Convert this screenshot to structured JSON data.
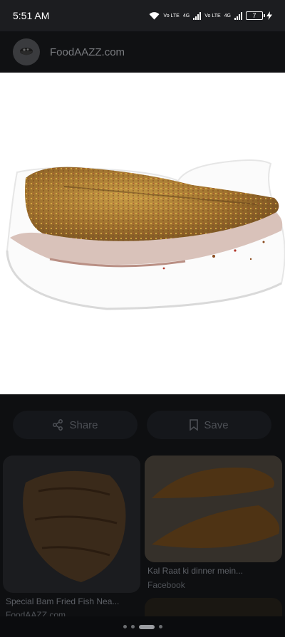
{
  "status_bar": {
    "time": "5:51 AM",
    "net1": "Vo LTE",
    "net2": "4G",
    "net3": "Vo LTE",
    "net4": "4G",
    "battery": "7"
  },
  "header": {
    "site_name": "FoodAAZZ.com"
  },
  "actions": {
    "share_label": "Share",
    "save_label": "Save"
  },
  "related": [
    {
      "title": "Special Bam Fried Fish Nea...",
      "source": "FoodAAZZ.com"
    },
    {
      "title": "Kal Raat ki dinner mein...",
      "source": "Facebook"
    }
  ],
  "colors": {
    "accent": "#e8a33c",
    "background": "#0b0c0e",
    "button": "#15171b"
  }
}
